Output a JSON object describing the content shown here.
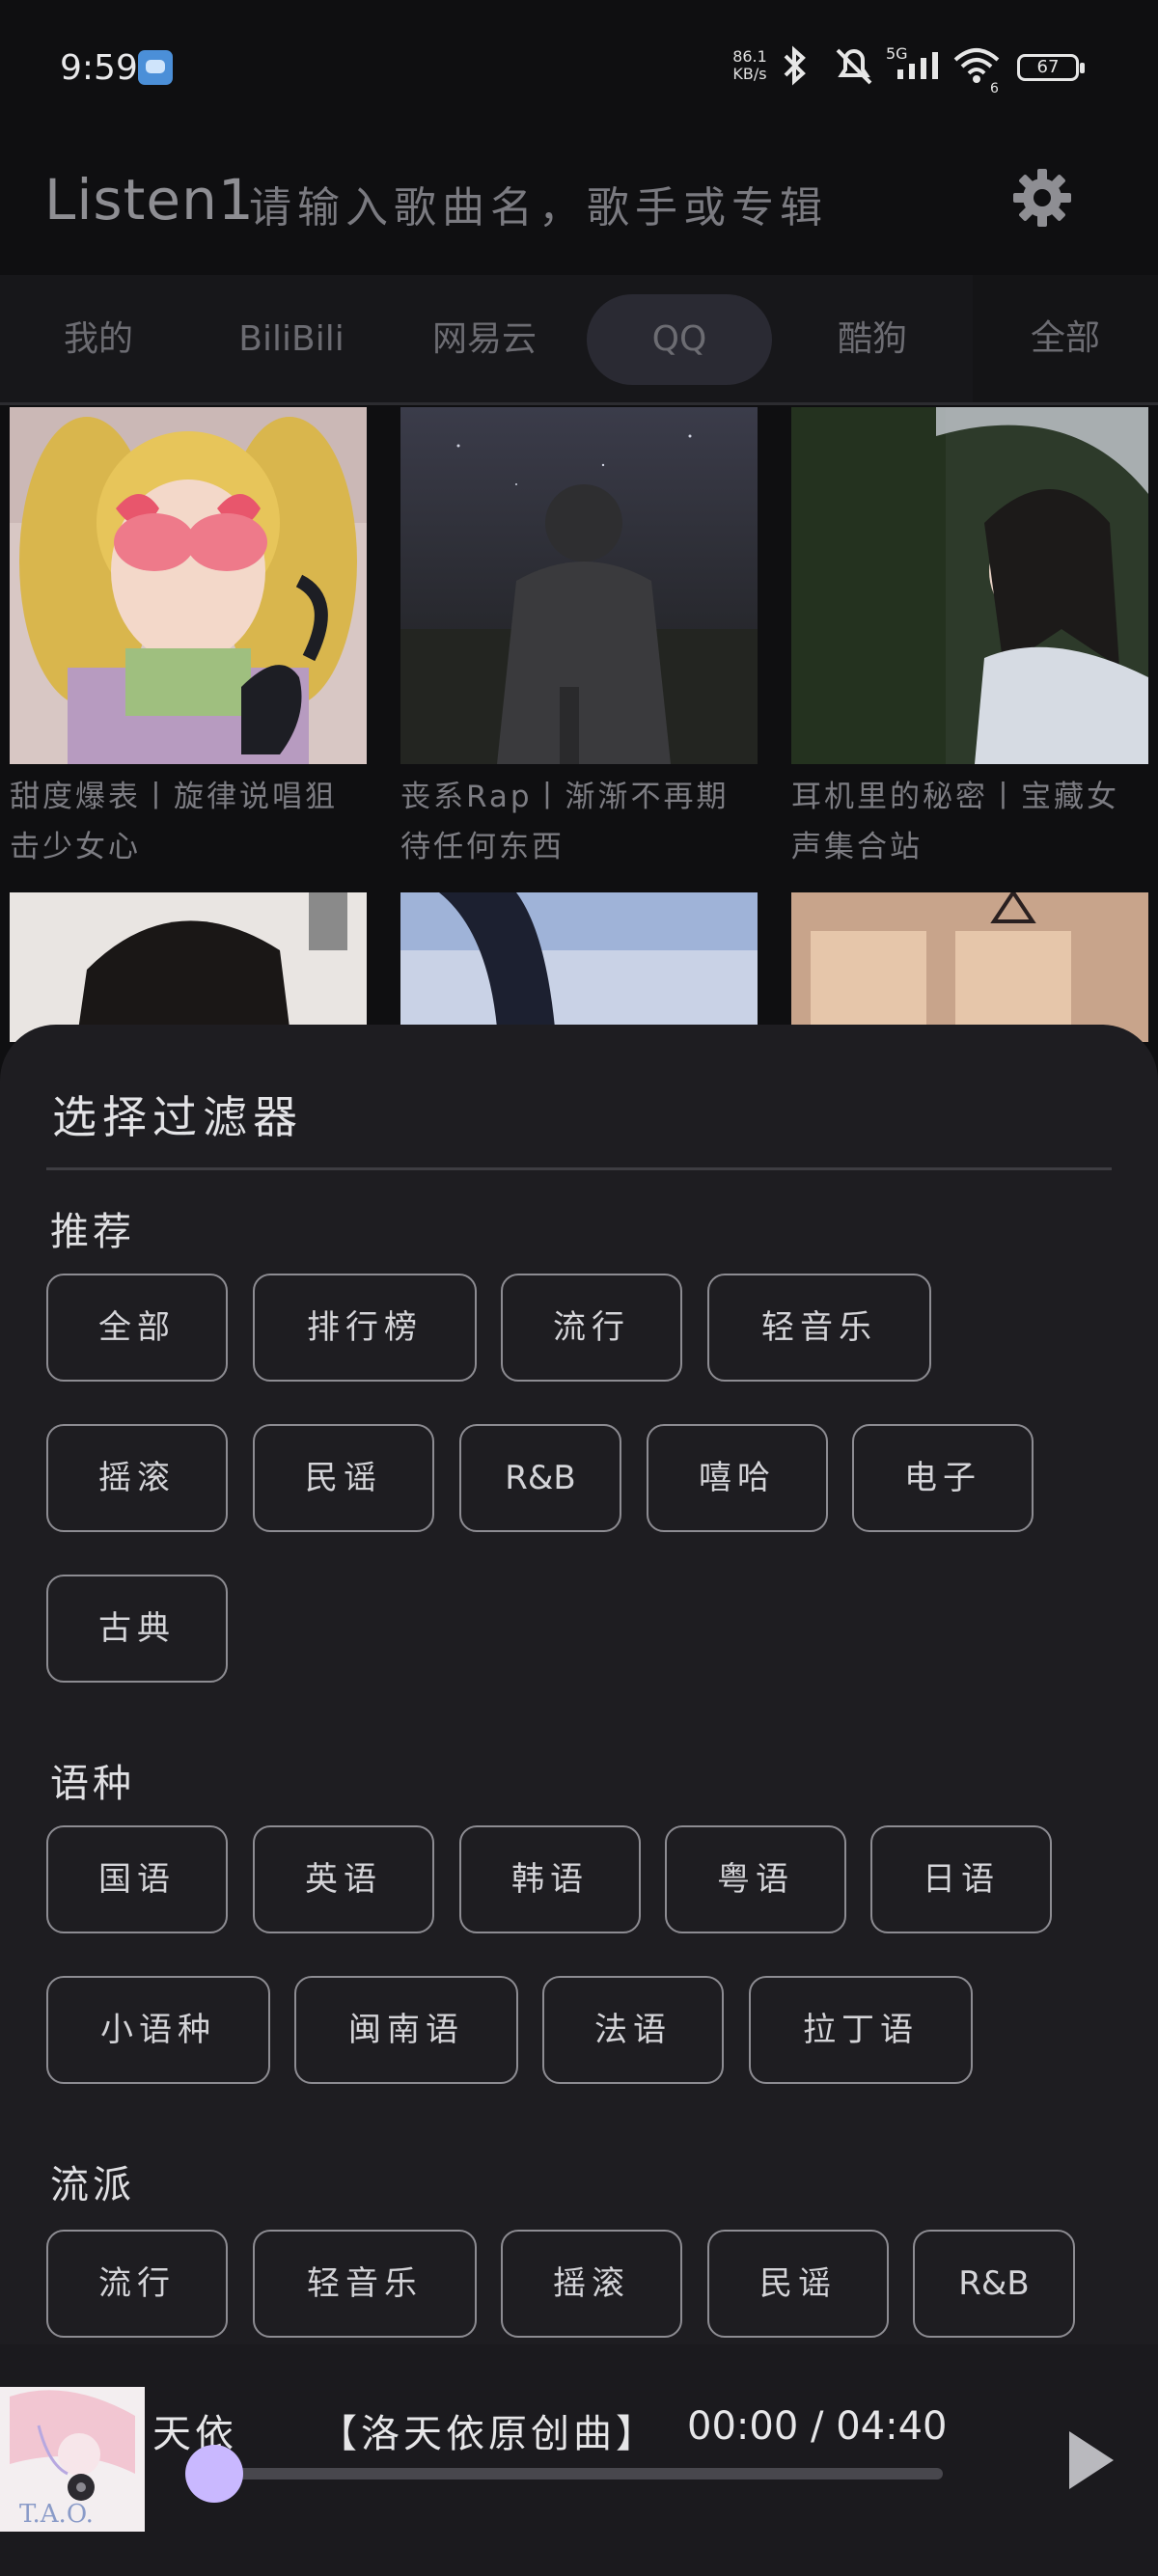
{
  "status_bar": {
    "time": "9:59",
    "net_speed_value": "86.1",
    "net_speed_unit": "KB/s",
    "signal_label": "5G",
    "wifi_sub": "6",
    "battery": "67"
  },
  "app_bar": {
    "title": "Listen1",
    "search_placeholder": "请输入歌曲名，歌手或专辑"
  },
  "tabs": {
    "items": [
      {
        "label": "我的"
      },
      {
        "label": "BiliBili"
      },
      {
        "label": "网易云"
      },
      {
        "label": "QQ",
        "active": true
      },
      {
        "label": "酷狗"
      }
    ],
    "all_label": "全部"
  },
  "playlists": [
    {
      "title_line1": "甜度爆表丨旋律说唱狙",
      "title_line2": "击少女心"
    },
    {
      "title_line1": "丧系Rap丨渐渐不再期",
      "title_line2": "待任何东西"
    },
    {
      "title_line1": "耳机里的秘密丨宝藏女",
      "title_line2": "声集合站"
    }
  ],
  "filter_sheet": {
    "title": "选择过滤器",
    "sections": [
      {
        "label": "推荐",
        "chips": [
          "全部",
          "排行榜",
          "流行",
          "轻音乐",
          "摇滚",
          "民谣",
          "R&B",
          "嘻哈",
          "电子",
          "古典"
        ]
      },
      {
        "label": "语种",
        "chips": [
          "国语",
          "英语",
          "韩语",
          "粤语",
          "日语",
          "小语种",
          "闽南语",
          "法语",
          "拉丁语"
        ]
      },
      {
        "label": "流派",
        "chips": [
          "流行",
          "轻音乐",
          "摇滚",
          "民谣",
          "R&B"
        ]
      }
    ]
  },
  "player": {
    "artist_fragment": "天依",
    "song_title": "【洛天依原创曲】",
    "current_time": "00:00",
    "separator": "/",
    "duration": "04:40",
    "progress": 0.0,
    "album_art_text": "T.A.O.",
    "accent_color": "#c9b8ff"
  }
}
